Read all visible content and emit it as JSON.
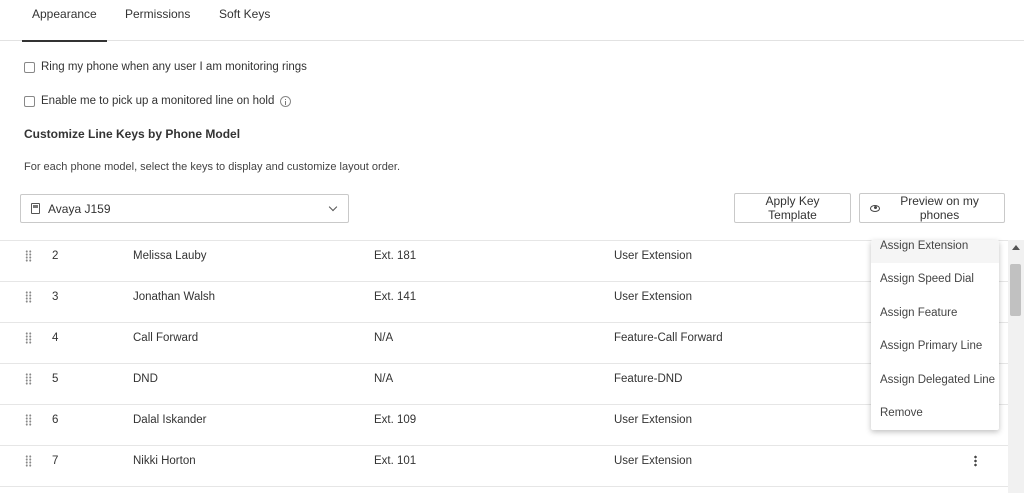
{
  "tabs": [
    {
      "label": "Appearance",
      "active": true
    },
    {
      "label": "Permissions",
      "active": false
    },
    {
      "label": "Soft Keys",
      "active": false
    }
  ],
  "options": {
    "ring_label": "Ring my phone when any user I am monitoring rings",
    "ring_checked": false,
    "pickup_label": "Enable me to pick up a monitored line on hold",
    "pickup_checked": false
  },
  "section": {
    "title": "Customize Line Keys by Phone Model",
    "description": "For each phone model, select the keys to display and customize layout order."
  },
  "phone_select": {
    "value": "Avaya J159"
  },
  "buttons": {
    "apply_template": "Apply Key Template",
    "preview": "Preview on my phones"
  },
  "line_keys": [
    {
      "num": "2",
      "name": "Melissa Lauby",
      "ext": "Ext. 181",
      "type": "User Extension"
    },
    {
      "num": "3",
      "name": "Jonathan Walsh",
      "ext": "Ext. 141",
      "type": "User Extension"
    },
    {
      "num": "4",
      "name": "Call Forward",
      "ext": "N/A",
      "type": "Feature-Call Forward"
    },
    {
      "num": "5",
      "name": "DND",
      "ext": "N/A",
      "type": "Feature-DND"
    },
    {
      "num": "6",
      "name": "Dalal Iskander",
      "ext": "Ext. 109",
      "type": "User Extension"
    },
    {
      "num": "7",
      "name": "Nikki Horton",
      "ext": "Ext. 101",
      "type": "User Extension"
    }
  ],
  "context_menu": {
    "items": [
      "Assign Extension",
      "Assign Speed Dial",
      "Assign Feature",
      "Assign Primary Line",
      "Assign Delegated Line",
      "Remove"
    ]
  }
}
